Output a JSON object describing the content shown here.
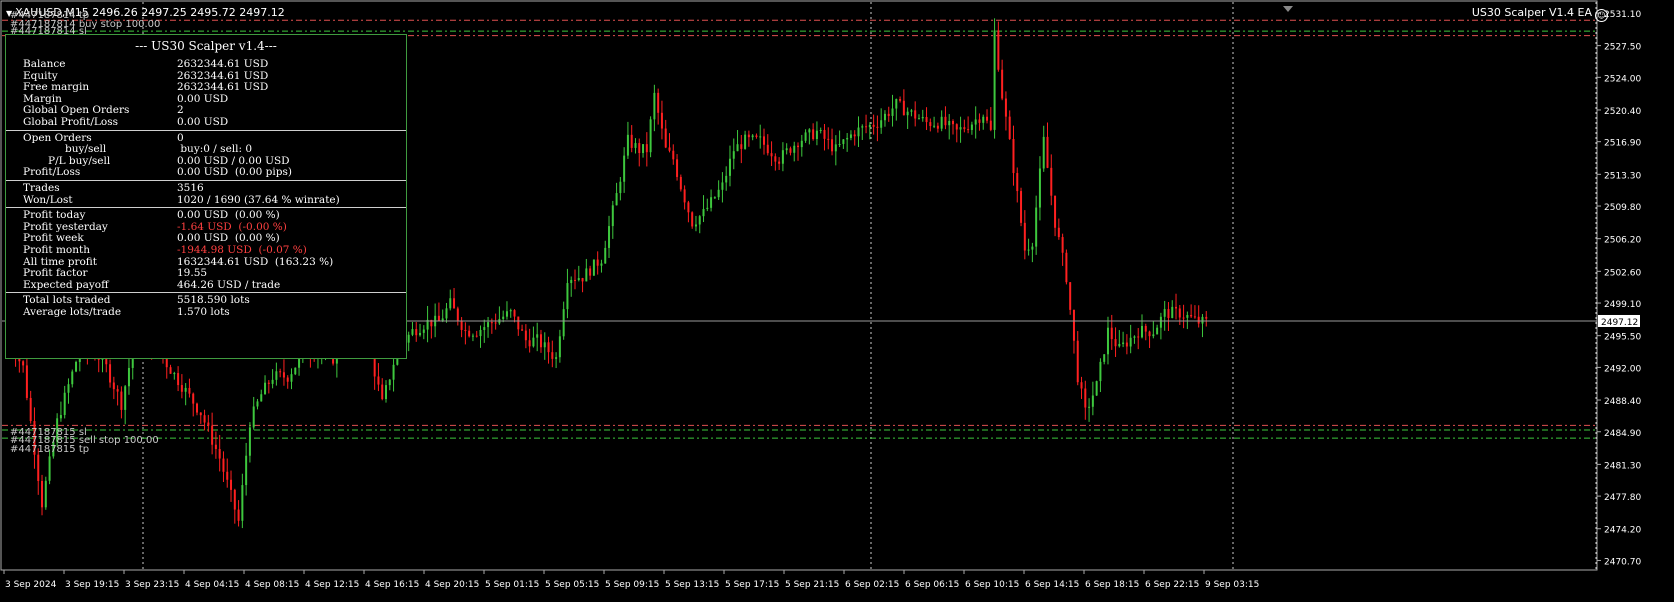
{
  "header": {
    "symbol_line": "XAUUSD,M15  2496.26 2497.25 2495.72 2497.12",
    "ea_label": "US30 Scalper V1.4 EA",
    "ea_icon": "smiley-icon"
  },
  "order_labels": {
    "top_tp": "#447187814 tp",
    "top_buy": "#447187814 buy stop 100.00",
    "top_sl": "#447187814 sl",
    "bot_sl": "#447187815 sl",
    "bot_sell": "#447187815 sell stop 100.00",
    "bot_tp": "#447187815 tp"
  },
  "panel": {
    "title": "--- US30 Scalper v1.4---",
    "account": [
      {
        "k": "Balance",
        "v": "2632344.61 USD"
      },
      {
        "k": "Equity",
        "v": "2632344.61 USD"
      },
      {
        "k": "Free margin",
        "v": "2632344.61 USD"
      },
      {
        "k": "Margin",
        "v": "0.00 USD"
      },
      {
        "k": "Global Open Orders",
        "v": "2"
      },
      {
        "k": "Global Profit/Loss",
        "v": "0.00 USD"
      }
    ],
    "orders": [
      {
        "k": "Open Orders",
        "v": "0"
      },
      {
        "k": "buy/sell",
        "v": " buy:0 / sell: 0",
        "indent": true
      },
      {
        "k": "P/L buy/sell",
        "v": "0.00 USD / 0.00 USD",
        "indent2": true
      },
      {
        "k": "Profit/Loss",
        "v": "0.00 USD  (0.00 pips)"
      }
    ],
    "trades": [
      {
        "k": "Trades",
        "v": "3516"
      },
      {
        "k": "Won/Lost",
        "v": "1020 / 1690 (37.64 % winrate)"
      }
    ],
    "profits": [
      {
        "k": "Profit today",
        "v": "0.00 USD  (0.00 %)"
      },
      {
        "k": "Profit yesterday",
        "v": "-1.64 USD  (-0.00 %)",
        "neg": true
      },
      {
        "k": "Profit week",
        "v": "0.00 USD  (0.00 %)"
      },
      {
        "k": "Profit month",
        "v": "-1944.98 USD  (-0.07 %)",
        "neg": true
      },
      {
        "k": "All time profit",
        "v": "1632344.61 USD  (163.23 %)"
      },
      {
        "k": "Profit factor",
        "v": "19.55"
      },
      {
        "k": "Expected payoff",
        "v": "464.26 USD / trade"
      }
    ],
    "lots": [
      {
        "k": "Total lots traded",
        "v": "5518.590 lots"
      },
      {
        "k": "Average lots/trade",
        "v": "1.570 lots"
      }
    ]
  },
  "chart_data": {
    "type": "candlestick",
    "symbol": "XAUUSD",
    "timeframe": "M15",
    "ylim": [
      2470.2,
      2532.2
    ],
    "y_ticks": [
      "2531.10",
      "2527.50",
      "2524.00",
      "2520.40",
      "2516.90",
      "2513.30",
      "2509.80",
      "2506.20",
      "2502.60",
      "2499.10",
      "2495.50",
      "2492.00",
      "2488.40",
      "2484.90",
      "2481.30",
      "2477.80",
      "2474.20",
      "2470.70"
    ],
    "current_price": "2497.12",
    "order_levels": {
      "top_tp": 2530.3,
      "top_buy": 2529.1,
      "top_sl": 2528.6,
      "bot_sl": 2485.6,
      "bot_sell": 2485.1,
      "bot_tp": 2484.2
    },
    "x_ticks": [
      "3 Sep 2024",
      "3 Sep 19:15",
      "3 Sep 23:15",
      "4 Sep 04:15",
      "4 Sep 08:15",
      "4 Sep 12:15",
      "4 Sep 16:15",
      "4 Sep 20:15",
      "5 Sep 01:15",
      "5 Sep 05:15",
      "5 Sep 09:15",
      "5 Sep 13:15",
      "5 Sep 17:15",
      "5 Sep 21:15",
      "6 Sep 02:15",
      "6 Sep 06:15",
      "6 Sep 10:15",
      "6 Sep 14:15",
      "6 Sep 18:15",
      "6 Sep 22:15",
      "9 Sep 03:15"
    ],
    "day_separators": [
      "4 Sep",
      "5 Sep",
      "6 Sep",
      "9 Sep"
    ],
    "path_points": [
      [
        0,
        2496
      ],
      [
        5,
        2492
      ],
      [
        10,
        2477
      ],
      [
        14,
        2486
      ],
      [
        20,
        2494
      ],
      [
        26,
        2493
      ],
      [
        31,
        2488
      ],
      [
        35,
        2496
      ],
      [
        42,
        2493
      ],
      [
        52,
        2487
      ],
      [
        57,
        2482
      ],
      [
        62,
        2475
      ],
      [
        65,
        2486
      ],
      [
        68,
        2489
      ],
      [
        71,
        2491
      ],
      [
        75,
        2491
      ],
      [
        80,
        2494
      ],
      [
        87,
        2493
      ],
      [
        90,
        2497
      ],
      [
        96,
        2495
      ],
      [
        100,
        2488
      ],
      [
        104,
        2494
      ],
      [
        108,
        2496
      ],
      [
        112,
        2497
      ],
      [
        115,
        2497
      ],
      [
        118,
        2499
      ],
      [
        122,
        2496
      ],
      [
        125,
        2496
      ],
      [
        129,
        2497
      ],
      [
        134,
        2498
      ],
      [
        138,
        2495
      ],
      [
        141,
        2495
      ],
      [
        146,
        2493
      ],
      [
        149,
        2502
      ],
      [
        153,
        2502
      ],
      [
        158,
        2504
      ],
      [
        162,
        2511
      ],
      [
        165,
        2517
      ],
      [
        168,
        2516
      ],
      [
        170,
        2516
      ],
      [
        172,
        2522
      ],
      [
        175,
        2516
      ],
      [
        177,
        2515
      ],
      [
        179,
        2512
      ],
      [
        182,
        2508
      ],
      [
        185,
        2509
      ],
      [
        190,
        2512
      ],
      [
        193,
        2516
      ],
      [
        196,
        2517
      ],
      [
        200,
        2517
      ],
      [
        205,
        2515
      ],
      [
        210,
        2517
      ],
      [
        215,
        2518
      ],
      [
        220,
        2516
      ],
      [
        225,
        2518
      ],
      [
        231,
        2519
      ],
      [
        236,
        2521
      ],
      [
        240,
        2520
      ],
      [
        244,
        2519
      ],
      [
        248,
        2519
      ],
      [
        252,
        2518
      ],
      [
        256,
        2519
      ],
      [
        259,
        2520
      ],
      [
        261,
        2518
      ],
      [
        262,
        2529
      ],
      [
        264,
        2522
      ],
      [
        267,
        2514
      ],
      [
        270,
        2505
      ],
      [
        272,
        2506
      ],
      [
        275,
        2517
      ],
      [
        278,
        2508
      ],
      [
        281,
        2502
      ],
      [
        284,
        2491
      ],
      [
        286,
        2487
      ],
      [
        289,
        2490
      ],
      [
        292,
        2496
      ],
      [
        295,
        2494
      ],
      [
        300,
        2496
      ],
      [
        304,
        2496
      ],
      [
        307,
        2498
      ],
      [
        311,
        2498
      ],
      [
        316,
        2497
      ],
      [
        318,
        2497
      ]
    ]
  }
}
